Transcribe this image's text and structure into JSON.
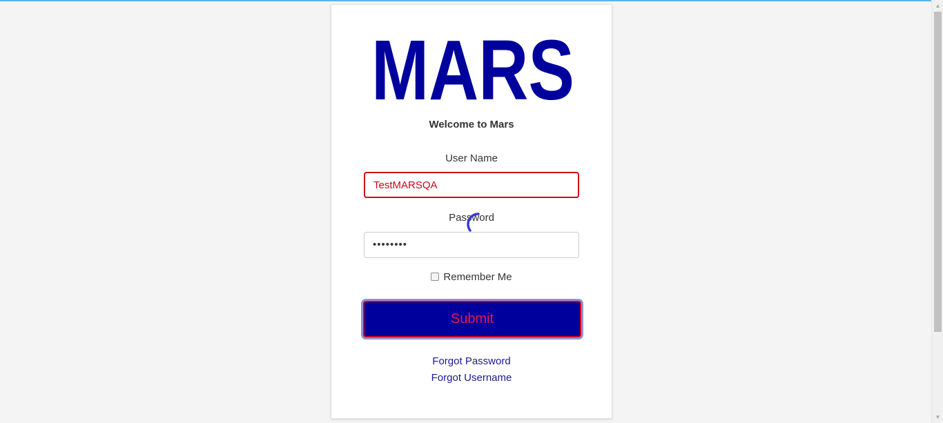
{
  "brand": {
    "logo_text": "MARS",
    "logo_color": "#00009c"
  },
  "login": {
    "welcome": "Welcome to Mars",
    "username_label": "User Name",
    "username_value": "TestMARSQA",
    "password_label": "Password",
    "password_value": "••••••••",
    "remember_label": "Remember Me",
    "remember_checked": false,
    "submit_label": "Submit",
    "forgot_password": "Forgot Password",
    "forgot_username": "Forgot Username",
    "loading": true
  },
  "colors": {
    "accent": "#00009c",
    "error": "#d0021b",
    "link": "#1a1a8c",
    "top_bar": "#5ab4ec"
  },
  "icons": {
    "spinner": "loading-spinner-icon",
    "scroll_up": "scroll-up-arrow-icon",
    "scroll_down": "scroll-down-arrow-icon"
  }
}
